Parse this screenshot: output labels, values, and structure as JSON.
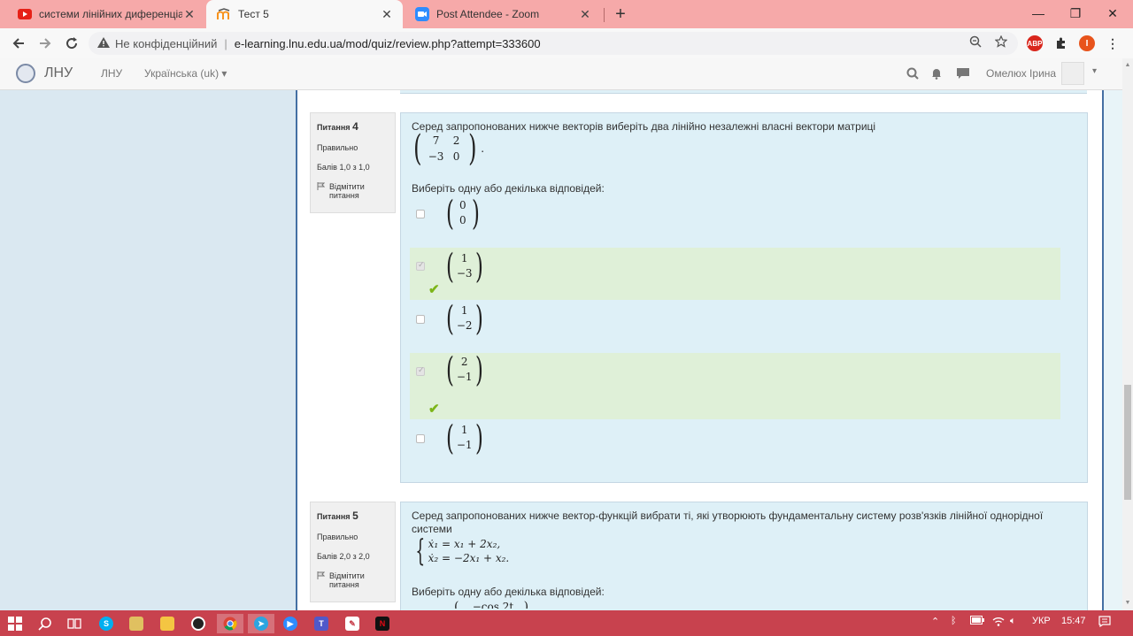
{
  "browser": {
    "tabs": [
      {
        "title": "системи лінійних диференціаль",
        "icon": "youtube-icon",
        "active": false
      },
      {
        "title": "Тест 5",
        "icon": "moodle-icon",
        "active": true
      },
      {
        "title": "Post Attendee - Zoom",
        "icon": "zoom-icon",
        "active": false
      }
    ],
    "close_glyph": "✕",
    "new_tab": "+",
    "window_controls": {
      "minimize": "—",
      "restore": "❐",
      "close": "✕"
    },
    "security_warning": "Не конфіденційний",
    "url": "e-learning.lnu.edu.ua/mod/quiz/review.php?attempt=333600",
    "profile_initial": "I",
    "adblock_label": "ABP",
    "colors": {
      "tabstrip": "#f6a9a9",
      "taskbar": "#c8424e",
      "profile": "#e8541c"
    }
  },
  "navbar": {
    "brand": "ЛНУ",
    "link": "ЛНУ",
    "language": "Українська (uk) ▾",
    "user_name": "Омелюх Ірина",
    "caret": "▾"
  },
  "question4": {
    "label": "Питання",
    "number": "4",
    "status": "Правильно",
    "points": "Балів 1,0 з 1,0",
    "flag": "Відмітити питання",
    "text": "Серед запропонованих нижче векторів виберіть два лінійно незалежні власні вектори матриці",
    "matrix": [
      "7",
      "2",
      "−3",
      "0"
    ],
    "matrix_end": ".",
    "prompt": "Виберіть одну або декілька відповідей:",
    "answers": [
      {
        "top": "0",
        "bottom": "0",
        "checked": false,
        "correct": false
      },
      {
        "top": "1",
        "bottom": "−3",
        "checked": true,
        "correct": true
      },
      {
        "top": "1",
        "bottom": "−2",
        "checked": false,
        "correct": false
      },
      {
        "top": "2",
        "bottom": "−1",
        "checked": true,
        "correct": true
      },
      {
        "top": "1",
        "bottom": "−1",
        "checked": false,
        "correct": false
      }
    ],
    "tick": "✔"
  },
  "question5": {
    "label": "Питання",
    "number": "5",
    "status": "Правильно",
    "points": "Балів 2,0 з 2,0",
    "flag": "Відмітити питання",
    "text": "Серед запропонованих нижче вектор-функцій вибрати ті, які утворюють фундаментальну систему розв'язків лінійної однорідної системи",
    "equations": [
      "ẋ₁ = x₁ + 2x₂,",
      "ẋ₂ = −2x₁ + x₂."
    ],
    "prompt": "Виберіть одну або декілька відповідей:",
    "partial_answer": "−cos 2t"
  },
  "taskbar": {
    "language": "УКР",
    "time": "15:47",
    "skype": "S",
    "teams": "T",
    "netflix": "N"
  }
}
